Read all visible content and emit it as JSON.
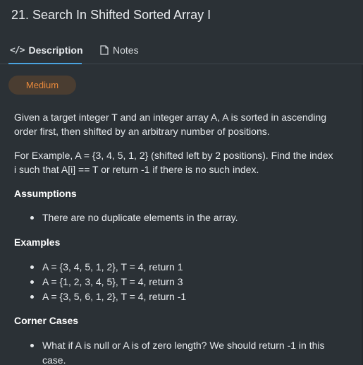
{
  "header": {
    "title": "21. Search In Shifted Sorted Array I"
  },
  "tabs": [
    {
      "label": "Description",
      "icon": "code-icon"
    },
    {
      "label": "Notes",
      "icon": "note-icon"
    }
  ],
  "problem": {
    "difficulty": "Medium",
    "paragraphs": [
      "Given a target integer T and an integer array A, A is sorted in ascending order first, then shifted by an arbitrary number of positions.",
      "For Example, A = {3, 4, 5, 1, 2} (shifted left by 2 positions). Find the index i such that A[i] == T or return -1 if there is no such index."
    ],
    "sections": [
      {
        "heading": "Assumptions",
        "items": [
          "There are no duplicate elements in the array."
        ]
      },
      {
        "heading": "Examples",
        "items": [
          "A = {3, 4, 5, 1, 2}, T = 4, return 1",
          "A = {1, 2, 3, 4, 5}, T = 4, return 3",
          "A = {3, 5, 6, 1, 2}, T = 4, return -1"
        ]
      },
      {
        "heading": "Corner Cases",
        "items": [
          "What if A is null or A is of zero length? We should return -1 in this case."
        ]
      }
    ]
  },
  "colors": {
    "background": "#2b3136",
    "accent": "#4aa3df",
    "difficulty_medium": "#e8893b"
  }
}
